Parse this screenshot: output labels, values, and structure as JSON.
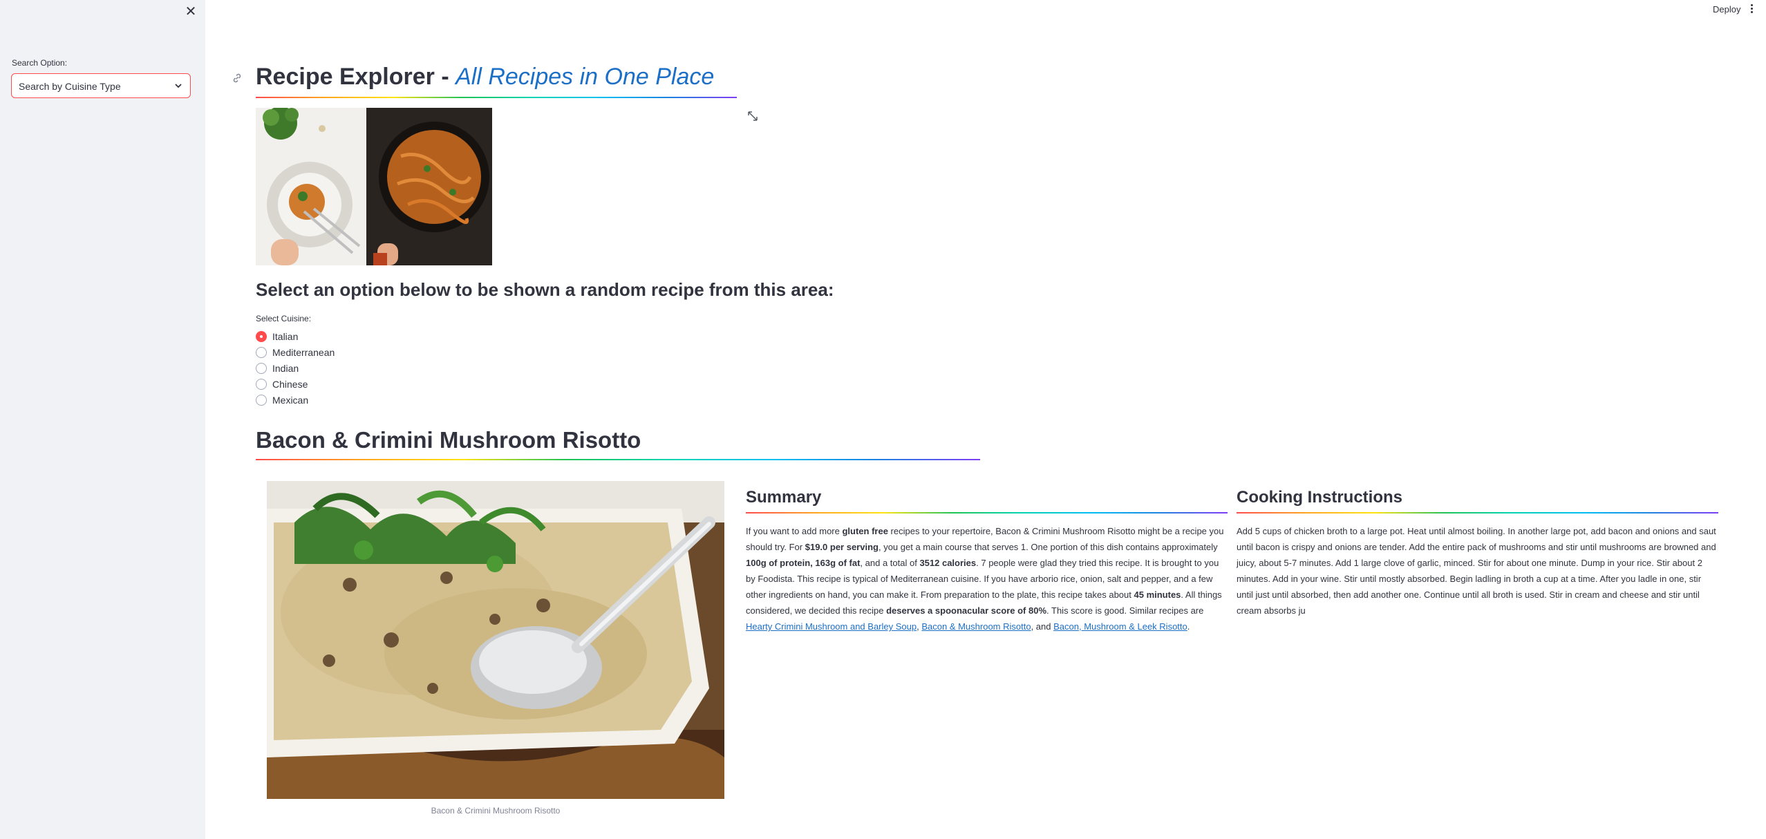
{
  "sidebar": {
    "search_option_label": "Search Option:",
    "search_option_value": "Search by Cuisine Type"
  },
  "topbar": {
    "deploy_label": "Deploy"
  },
  "header": {
    "title_main": "Recipe Explorer - ",
    "title_sub": "All Recipes in One Place"
  },
  "prompt": "Select an option below to be shown a random recipe from this area:",
  "cuisine": {
    "label": "Select Cuisine:",
    "options": [
      "Italian",
      "Mediterranean",
      "Indian",
      "Chinese",
      "Mexican"
    ],
    "selected": "Italian"
  },
  "recipe": {
    "title": "Bacon & Crimini Mushroom Risotto",
    "image_caption": "Bacon & Crimini Mushroom Risotto",
    "summary_heading": "Summary",
    "summary": {
      "p1": "If you want to add more ",
      "b1": "gluten free",
      "p2": " recipes to your repertoire, Bacon & Crimini Mushroom Risotto might be a recipe you should try. For ",
      "b2": "$19.0 per serving",
      "p3": ", you get a main course that serves 1. One portion of this dish contains approximately ",
      "b3": "100g of protein, 163g of fat",
      "p4": ", and a total of ",
      "b4": "3512 calories",
      "p5": ". 7 people were glad they tried this recipe. It is brought to you by Foodista. This recipe is typical of Mediterranean cuisine. If you have arborio rice, onion, salt and pepper, and a few other ingredients on hand, you can make it. From preparation to the plate, this recipe takes about ",
      "b5": "45 minutes",
      "p6": ". All things considered, we decided this recipe ",
      "b6": "deserves a spoonacular score of 80%",
      "p7": ". This score is good. Similar recipes are ",
      "link1": "Hearty Crimini Mushroom and Barley Soup",
      "sep1": ", ",
      "link2": "Bacon & Mushroom Risotto",
      "sep2": ", and ",
      "link3": "Bacon, Mushroom & Leek Risotto",
      "end": "."
    },
    "instructions_heading": "Cooking Instructions",
    "instructions": "Add 5 cups of chicken broth to a large pot. Heat until almost boiling. In another large pot, add bacon and onions and saut until bacon is crispy and onions are tender. Add the entire pack of mushrooms and stir until mushrooms are browned and juicy, about 5-7 minutes. Add 1 large clove of garlic, minced. Stir for about one minute. Dump in your rice. Stir about 2 minutes. Add in your wine. Stir until mostly absorbed. Begin ladling in broth a cup at a time. After you ladle in one, stir until just until absorbed, then add another one. Continue until all broth is used. Stir in cream and cheese and stir until cream absorbs ju"
  },
  "colors": {
    "accent": "#ff4b4b",
    "link": "#1c6fc7",
    "sidebar_bg": "#f0f2f6",
    "text": "#31333f"
  },
  "icons": [
    "close-icon",
    "chevron-down-icon",
    "link-icon",
    "expand-icon",
    "kebab-menu-icon"
  ]
}
